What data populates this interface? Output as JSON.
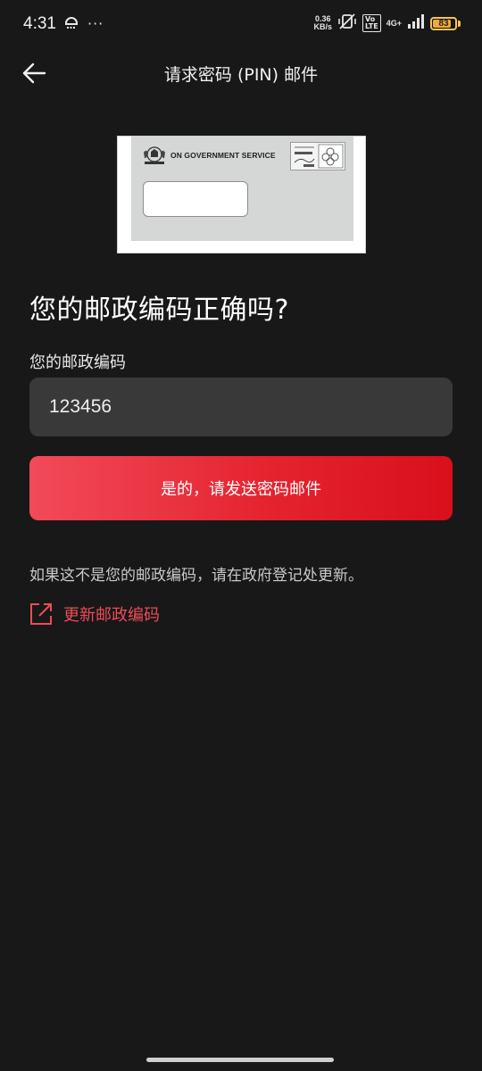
{
  "status_bar": {
    "time": "4:31",
    "more_dots": "···",
    "speed_value": "0.36",
    "speed_unit": "KB/s",
    "volte": "Vo\nLTE",
    "network": "4G+",
    "battery_level": "83",
    "battery_fraction": 0.83
  },
  "header": {
    "title": "请求密码 (PIN) 邮件"
  },
  "envelope": {
    "service_text": "ON GOVERNMENT SERVICE"
  },
  "main": {
    "question": "您的邮政编码正确吗?",
    "field_label": "您的邮政编码",
    "postal_code": "123456",
    "confirm_button": "是的，请发送密码邮件",
    "info_text": "如果这不是您的邮政编码，请在政府登记处更新。",
    "update_link": "更新邮政编码"
  },
  "colors": {
    "background": "#181818",
    "accent": "#e52430",
    "link": "#ee4b57",
    "input_bg": "#393939"
  }
}
